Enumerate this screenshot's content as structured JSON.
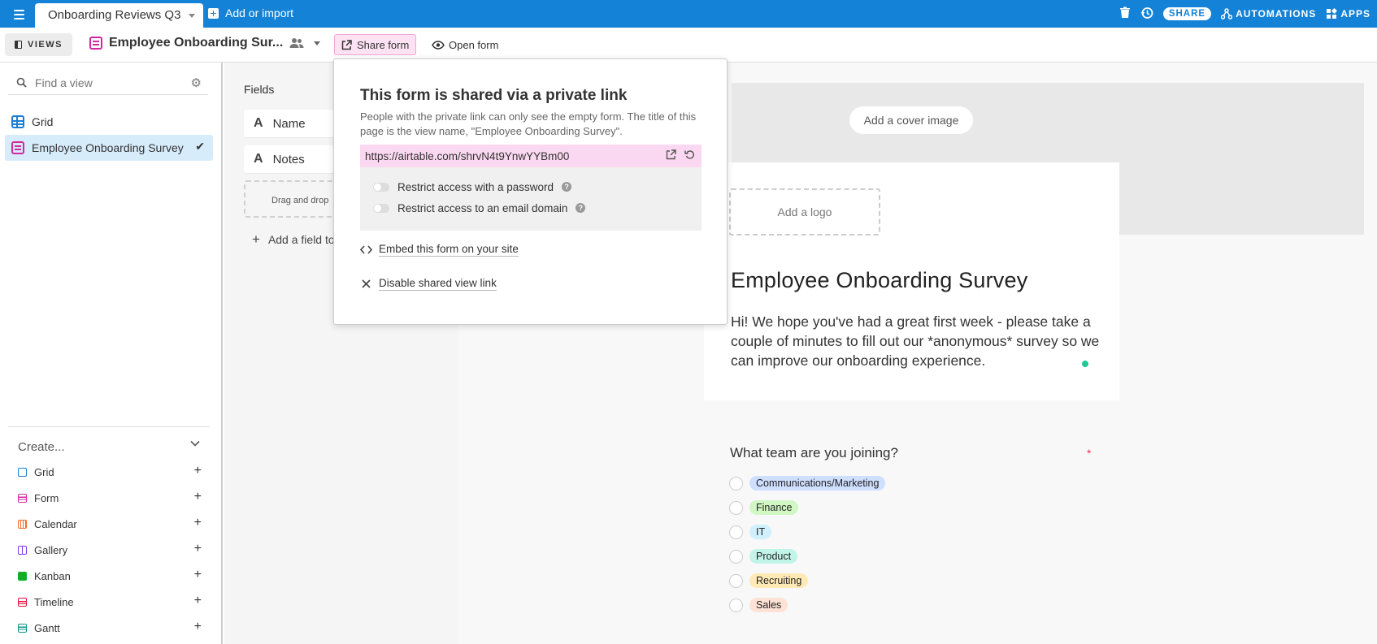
{
  "topbar": {
    "base_name": "Onboarding Reviews Q3",
    "add_import": "Add or import",
    "share": "SHARE",
    "automations": "AUTOMATIONS",
    "apps": "APPS"
  },
  "toolbar": {
    "views": "VIEWS",
    "view_name": "Employee Onboarding Sur...",
    "share_form": "Share form",
    "open_form": "Open form"
  },
  "sidebar": {
    "search_placeholder": "Find a view",
    "views": [
      {
        "label": "Grid"
      },
      {
        "label": "Employee Onboarding Survey"
      }
    ],
    "create_label": "Create...",
    "create_items": [
      {
        "label": "Grid",
        "color": "#1c7cd6"
      },
      {
        "label": "Form",
        "color": "#d4279e"
      },
      {
        "label": "Calendar",
        "color": "#f06a2a"
      },
      {
        "label": "Gallery",
        "color": "#7c39ed"
      },
      {
        "label": "Kanban",
        "color": "#11af22"
      },
      {
        "label": "Timeline",
        "color": "#dc143c"
      },
      {
        "label": "Gantt",
        "color": "#0d9488"
      }
    ]
  },
  "fields_panel": {
    "title": "Fields",
    "fields": [
      {
        "label": "Name"
      },
      {
        "label": "Notes"
      }
    ],
    "drop_hint": "Drag and drop",
    "add_field": "Add a field to"
  },
  "popup": {
    "title": "This form is shared via a private link",
    "description": "People with the private link can only see the empty form. The title of this page is the view name, \"Employee Onboarding Survey\".",
    "url": "https://airtable.com/shrvN4t9YnwYYBm00",
    "restrict_password": "Restrict access with a password",
    "restrict_email": "Restrict access to an email domain",
    "embed": "Embed this form on your site",
    "disable": "Disable shared view link"
  },
  "form": {
    "cover_button": "Add a cover image",
    "logo_button": "Add a logo",
    "title": "Employee Onboarding Survey",
    "description": "Hi! We hope you've had a great first week - please take a couple of minutes to fill out our *anonymous* survey so we can improve our onboarding experience.",
    "question": "What team are you joining?",
    "required_mark": "*",
    "options": [
      {
        "label": "Communications/Marketing",
        "color": "#cfdfff"
      },
      {
        "label": "Finance",
        "color": "#d1f7c4"
      },
      {
        "label": "IT",
        "color": "#d0f0fd"
      },
      {
        "label": "Product",
        "color": "#c2f5e9"
      },
      {
        "label": "Recruiting",
        "color": "#ffeab6"
      },
      {
        "label": "Sales",
        "color": "#fee2d5"
      }
    ]
  }
}
